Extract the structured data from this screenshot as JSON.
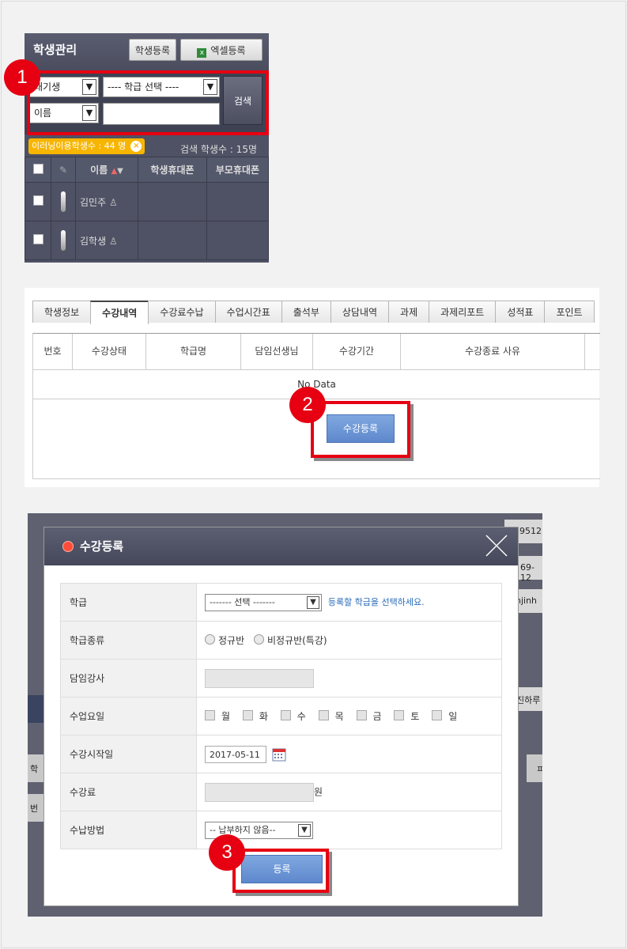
{
  "panel1": {
    "title": "학생관리",
    "register_btn": "학생등록",
    "excel_btn": "엑셀등록",
    "status_select": "대기생",
    "class_select": "---- 학급 선택 ----",
    "field_select": "이름",
    "search_placeholder": "",
    "search_btn": "검색",
    "e_learning_count": "이러닝이용학생수 : 44 명",
    "search_count": "검색 학생수 : 15명",
    "columns": [
      "이름",
      "학생휴대폰",
      "부모휴대폰"
    ],
    "students": [
      "김민주",
      "김학생"
    ],
    "step": "1"
  },
  "panel2": {
    "tabs": [
      "학생정보",
      "수강내역",
      "수강료수납",
      "수업시간표",
      "출석부",
      "상담내역",
      "과제",
      "과제리포트",
      "성적표",
      "포인트"
    ],
    "active_tab": "수강내역",
    "columns": [
      "번호",
      "수강상태",
      "학급명",
      "담임선생님",
      "수강기간",
      "수강종료 사유"
    ],
    "empty_text": "No Data",
    "enroll_btn": "수강등록",
    "step": "2"
  },
  "panel3": {
    "bg_fragments": [
      "n9512",
      "69-12",
      "hjinh",
      "진하루",
      "학",
      "번",
      "ㅍ"
    ],
    "modal_title": "수강등록",
    "class_label": "학급",
    "class_select": "------- 선택 -------",
    "class_hint": "등록할 학급을 선택하세요.",
    "class_type_label": "학급종류",
    "class_type_options": [
      "정규반",
      "비정규반(특강)"
    ],
    "teacher_label": "담임강사",
    "days_label": "수업요일",
    "days": [
      "월",
      "화",
      "수",
      "목",
      "금",
      "토",
      "일"
    ],
    "start_label": "수강시작일",
    "start_date": "2017-05-11",
    "fee_label": "수강료",
    "fee_unit": "원",
    "pay_label": "수납방법",
    "pay_select": "-- 납부하지 않음--",
    "submit_btn": "등록",
    "step": "3"
  },
  "colors": {
    "accent_red": "#e60012",
    "button_blue": "#6b93d6",
    "pill_yellow": "#f7b500"
  }
}
